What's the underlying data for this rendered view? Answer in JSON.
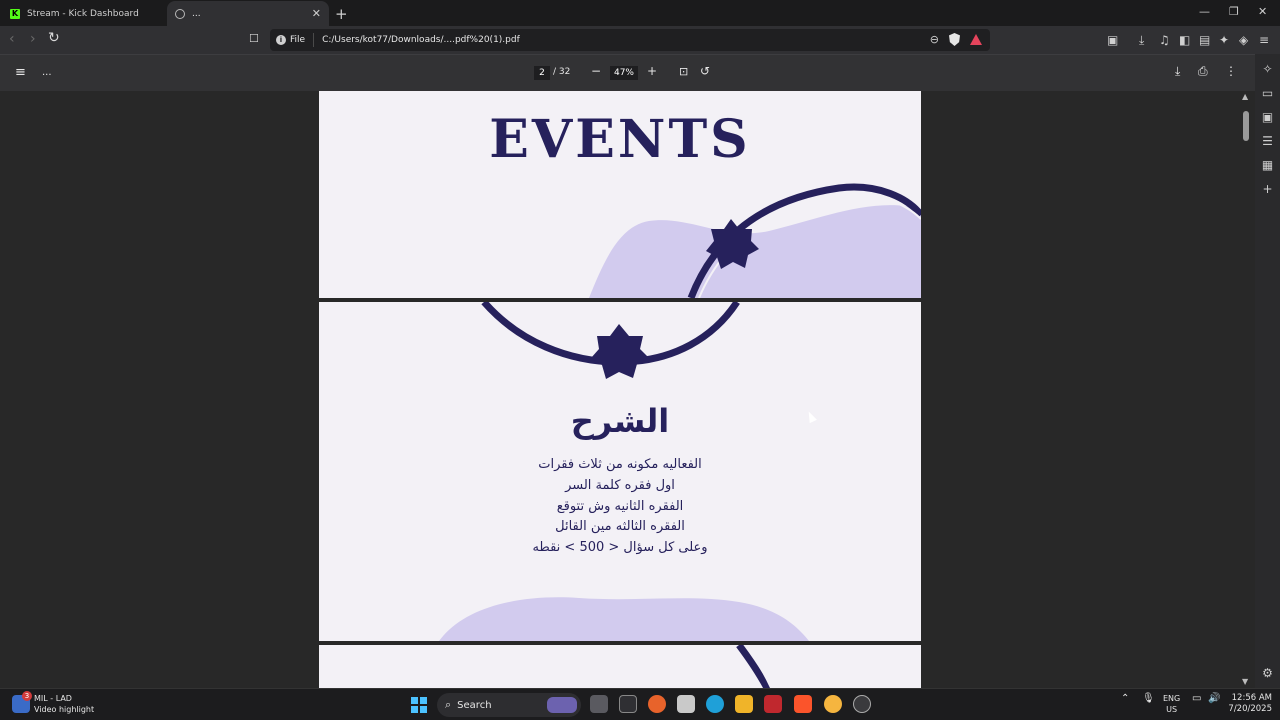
{
  "tabs": [
    {
      "title": "Stream - Kick Dashboard",
      "icon": "kick-icon"
    },
    {
      "title": "...",
      "icon": "globe-icon"
    }
  ],
  "address_bar": {
    "scheme_label": "File",
    "url": "C:/Users/kot77/Downloads/....pdf%20(1).pdf"
  },
  "pdf_toolbar": {
    "title": "...",
    "current_page": "2",
    "page_total": "/ 32",
    "zoom": "47%"
  },
  "pages": {
    "page1_title": "EVENTS",
    "page2_heading": "الشرح",
    "page2_lines": [
      "الفعاليه مكونه من ثلاث فقرات",
      "اول فقره  كلمة السر",
      "الفقره الثانيه وش تتوقع",
      "الفقره الثالثه مين القائل",
      "وعلى كل سؤال < 500 > نقطه"
    ]
  },
  "colors": {
    "brand_navy": "#26215c",
    "lavender": "#d2cbee",
    "page_bg": "#f3f1f6"
  },
  "taskbar": {
    "notification_title": "MIL - LAD",
    "notification_sub": "Video highlight",
    "notification_count": "3",
    "search_placeholder": "Search",
    "lang_line1": "ENG",
    "lang_line2": "US",
    "time": "12:56 AM",
    "date": "7/20/2025"
  }
}
